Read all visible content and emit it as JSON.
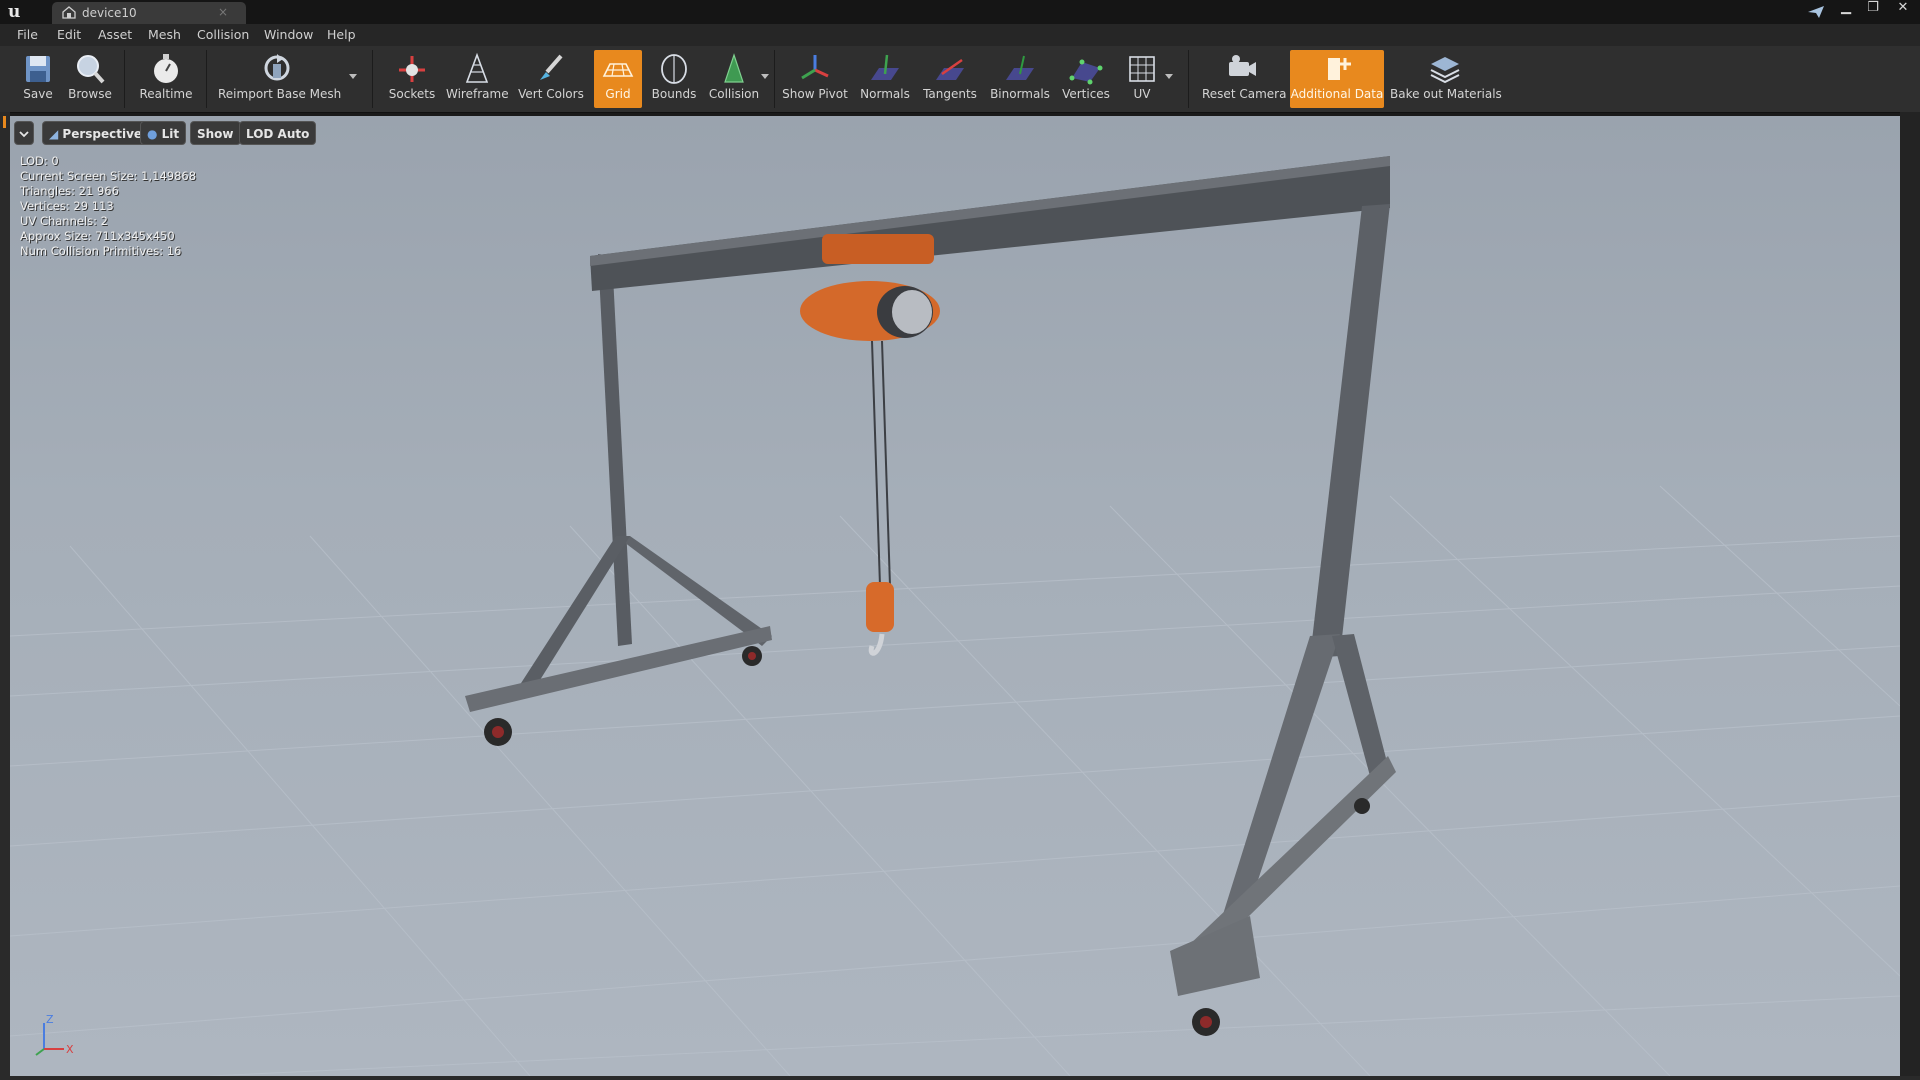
{
  "window": {
    "tab_title": "device10",
    "tab_close": "×",
    "minimize": "▁",
    "restore": "❐",
    "close": "✕"
  },
  "menu": [
    "File",
    "Edit",
    "Asset",
    "Mesh",
    "Collision",
    "Window",
    "Help"
  ],
  "toolbar": {
    "save": "Save",
    "browse": "Browse",
    "realtime": "Realtime",
    "reimport": "Reimport Base Mesh",
    "sockets": "Sockets",
    "wireframe": "Wireframe",
    "vert_colors": "Vert Colors",
    "grid": "Grid",
    "bounds": "Bounds",
    "collision": "Collision",
    "show_pivot": "Show Pivot",
    "normals": "Normals",
    "tangents": "Tangents",
    "binormals": "Binormals",
    "vertices": "Vertices",
    "uv": "UV",
    "reset_camera": "Reset Camera",
    "additional_data": "Additional Data",
    "bake_out": "Bake out Materials",
    "active_color": "#e8891e"
  },
  "viewport": {
    "perspective": "Perspective",
    "lit": "Lit",
    "show": "Show",
    "lod": "LOD Auto",
    "stats": [
      "LOD:  0",
      "Current Screen Size:  1,149868",
      "Triangles:  21 966",
      "Vertices:  29 113",
      "UV Channels:  2",
      "Approx Size: 711x345x450",
      "Num Collision Primitives:  16"
    ],
    "axis_x": "X",
    "axis_z": "Z"
  }
}
